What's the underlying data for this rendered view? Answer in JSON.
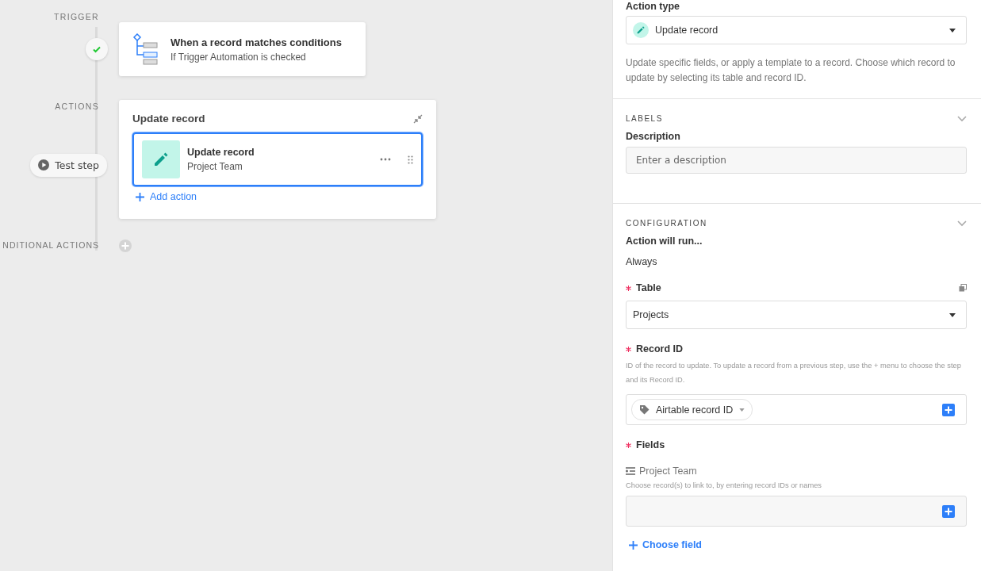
{
  "flow": {
    "trigger_label": "TRIGGER",
    "trigger": {
      "title": "When a record matches conditions",
      "subtitle": "If Trigger Automation is checked"
    },
    "actions_label": "ACTIONS",
    "actions_card": {
      "title": "Update record",
      "steps": [
        {
          "title": "Update record",
          "subtitle": "Project Team",
          "selected": true
        }
      ],
      "add_action": "Add action"
    },
    "test_step": "Test step",
    "conditional_label": "NDITIONAL ACTIONS"
  },
  "panel": {
    "action_type_label": "Action type",
    "action_type": "Update record",
    "description": "Update specific fields, or apply a template to a record. Choose which record to update by selecting its table and record ID.",
    "sections": [
      {
        "title": "LABELS",
        "expanded": true
      },
      {
        "title": "CONFIGURATION",
        "expanded": true
      }
    ],
    "description_label": "Description",
    "description_placeholder": "Enter a description",
    "run_label": "Action will run...",
    "run_value": "Always",
    "table": {
      "label": "Table",
      "required": true,
      "value": "Projects"
    },
    "record_id": {
      "label": "Record ID",
      "required": true,
      "help": "ID of the record to update. To update a record from a previous step, use the + menu to choose the step and its Record ID.",
      "token": "Airtable record ID"
    },
    "fields": {
      "label": "Fields",
      "required": true,
      "items": [
        {
          "name": "Project Team",
          "help": "Choose record(s) to link to, by entering record IDs or names"
        }
      ],
      "choose": "Choose field"
    }
  }
}
